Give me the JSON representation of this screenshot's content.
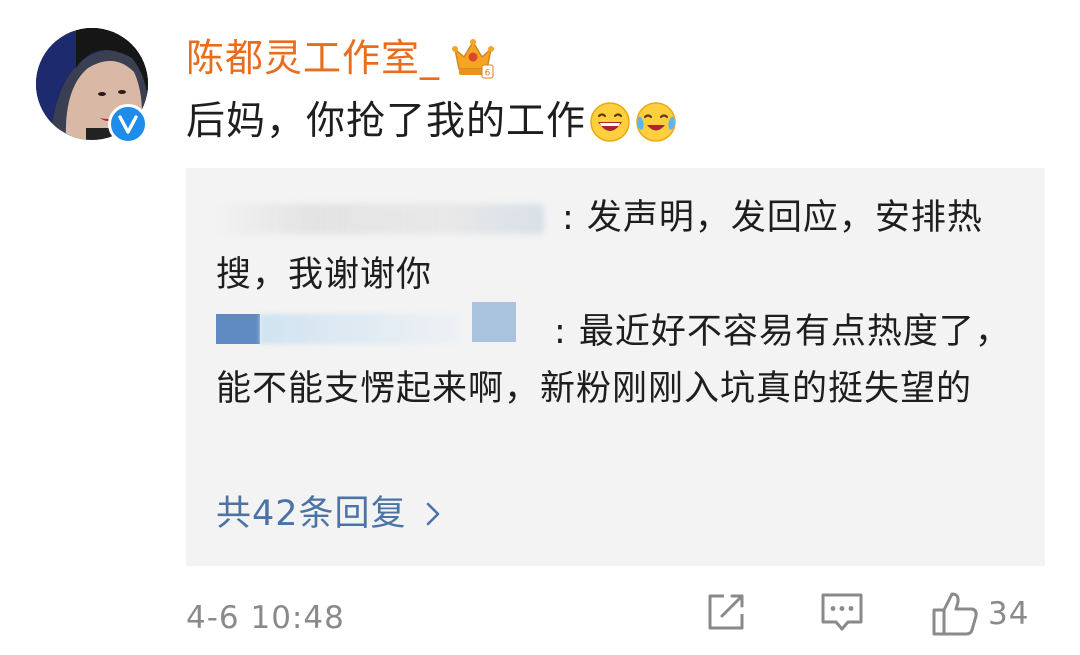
{
  "post": {
    "author": {
      "name": "陈都灵工作室_",
      "verified": true,
      "badge_icon": "crown-badge-icon",
      "verified_icon": "verified-v-icon",
      "name_color": "#e86d1d"
    },
    "comment_text": "后妈，你抢了我的工作",
    "emojis": [
      "laughing-face-icon",
      "tears-of-joy-face-icon"
    ]
  },
  "replies": {
    "items": [
      {
        "text": ": 发声明，发回应，安排热搜，我谢谢你"
      },
      {
        "text": ": 最近好不容易有点热度了，能不能支愣起来啊，新粉刚刚入坑真的挺失望的"
      }
    ],
    "count_label": "共42条回复",
    "link_color": "#4b74a5"
  },
  "footer": {
    "timestamp": "4-6 10:48",
    "like_count": "34",
    "icons": [
      "share-icon",
      "comment-icon",
      "like-thumb-icon"
    ]
  }
}
